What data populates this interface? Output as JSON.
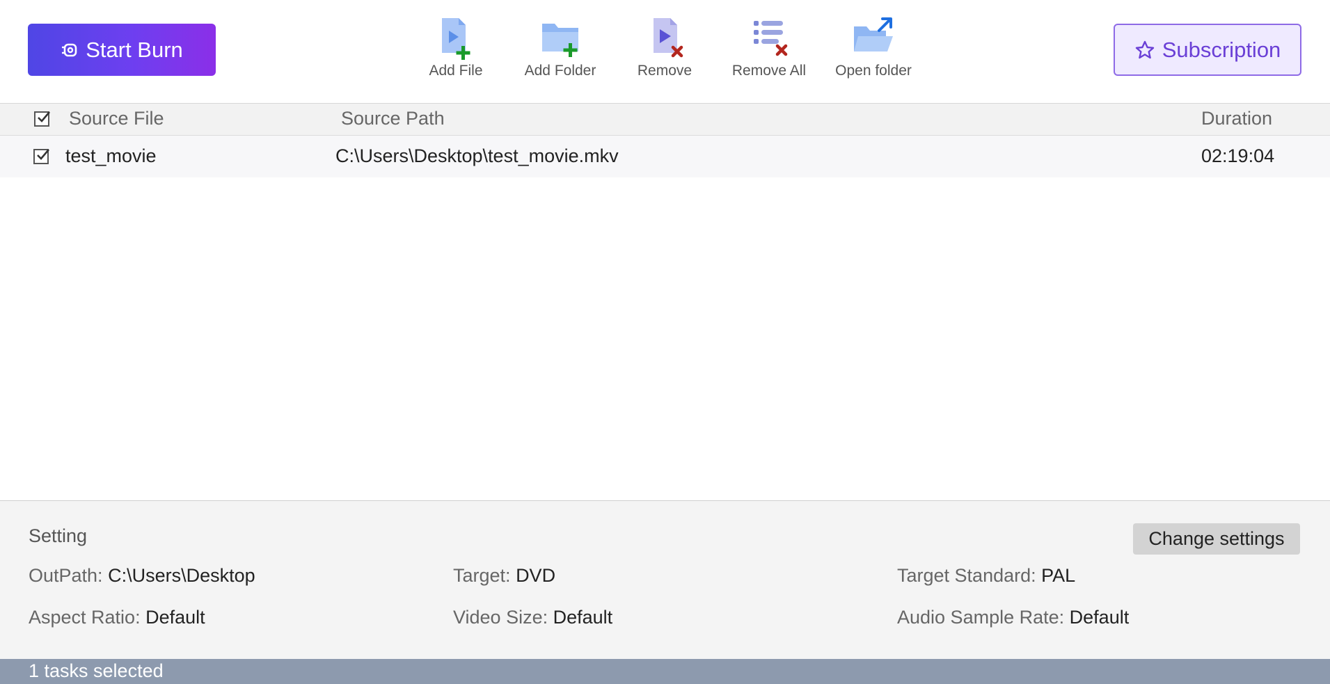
{
  "toolbar": {
    "start_burn": "Start Burn",
    "add_file": "Add File",
    "add_folder": "Add Folder",
    "remove": "Remove",
    "remove_all": "Remove All",
    "open_folder": "Open folder",
    "subscription": "Subscription"
  },
  "table": {
    "columns": {
      "source_file": "Source File",
      "source_path": "Source Path",
      "duration": "Duration"
    },
    "rows": [
      {
        "checked": true,
        "source_file": "test_movie",
        "source_path": "C:\\Users\\Desktop\\test_movie.mkv",
        "duration": "02:19:04"
      }
    ]
  },
  "settings": {
    "title": "Setting",
    "change_button": "Change settings",
    "outpath_label": "OutPath:",
    "outpath_value": "C:\\Users\\Desktop",
    "target_label": "Target:",
    "target_value": "DVD",
    "target_standard_label": "Target Standard:",
    "target_standard_value": "PAL",
    "aspect_ratio_label": "Aspect Ratio:",
    "aspect_ratio_value": "Default",
    "video_size_label": "Video Size:",
    "video_size_value": "Default",
    "audio_sample_rate_label": "Audio Sample Rate:",
    "audio_sample_rate_value": "Default"
  },
  "status": {
    "text": "1 tasks selected"
  },
  "colors": {
    "accent_start": "#4f46e5",
    "accent_end": "#8b2fe8",
    "subscription": "#6a3fd6",
    "add_plus": "#1a9a2a",
    "remove_x": "#b3261e",
    "statusbar": "#8d9aae"
  },
  "icons": [
    "burn-icon",
    "add-file-icon",
    "add-folder-icon",
    "remove-icon",
    "remove-all-icon",
    "open-folder-icon",
    "star-icon",
    "checkbox-icon"
  ]
}
